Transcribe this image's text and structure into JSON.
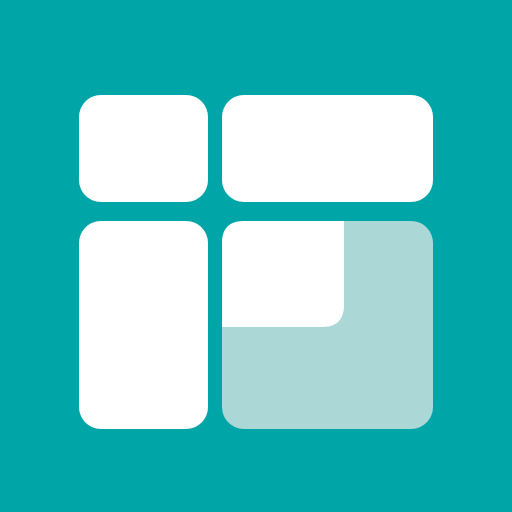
{
  "app_icon": {
    "icon_name": "grid-layout-icon",
    "colors": {
      "background": "#00a6a7",
      "tile": "#ffffff",
      "highlight_tile": "#acd7d7"
    }
  }
}
